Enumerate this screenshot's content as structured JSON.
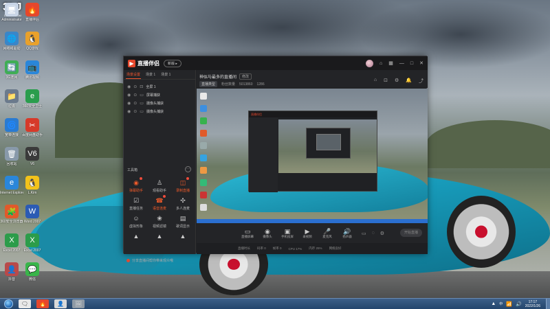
{
  "watermark": "3LJ",
  "watermark_sub": "DOUYU.COM",
  "desktop": {
    "icons_col1": [
      {
        "label": "Administrator",
        "glyph": "🖥"
      },
      {
        "label": "网络和驱动",
        "glyph": "🌐"
      },
      {
        "label": "3G连网",
        "glyph": "🔄"
      },
      {
        "label": "垃圾",
        "glyph": "📁"
      },
      {
        "label": "宽带连接",
        "glyph": "🌀"
      },
      {
        "label": "回收站",
        "glyph": "🗑"
      },
      {
        "label": "Internet Explorer",
        "glyph": "e"
      },
      {
        "label": "360安全浏览器",
        "glyph": "🧩"
      },
      {
        "label": "Excel 2007",
        "glyph": "X"
      },
      {
        "label": "抖音",
        "glyph": "👤"
      }
    ],
    "icons_col2": [
      {
        "label": "直播伴侣",
        "glyph": "🔥"
      },
      {
        "label": "QQ游戏",
        "glyph": "🐧"
      },
      {
        "label": "腾讯视频",
        "glyph": "📺"
      },
      {
        "label": "360安全卫士",
        "glyph": "e"
      },
      {
        "label": "百度网盘助手",
        "glyph": "✂"
      },
      {
        "label": "V6",
        "glyph": "V6"
      },
      {
        "label": "L.Kim",
        "glyph": "🐧"
      },
      {
        "label": "Word 2007",
        "glyph": "W"
      },
      {
        "label": "Excel 2007",
        "glyph": "X"
      },
      {
        "label": "微信",
        "glyph": "💬"
      }
    ]
  },
  "app": {
    "logo_mark": "▶",
    "logo_text": "直播伴侣",
    "version_label": "新版 ▸",
    "titlebar_glyphs": [
      "⌂",
      "▦",
      "—",
      "□",
      "✕"
    ],
    "scene_tabs": [
      "场景设置",
      "场景 1",
      "场景 1"
    ],
    "sources": [
      "全屏 1",
      "屏幕捕获",
      "摄像头捕获",
      "摄像头捕获"
    ],
    "tools_heading": "工具箱",
    "tools_more": "···",
    "tools": [
      {
        "label": "弹幕助手",
        "glyph": "◉",
        "red": true,
        "dot": true
      },
      {
        "label": "观看助手",
        "glyph": "♙",
        "red": false,
        "dot": false
      },
      {
        "label": "录制直播",
        "glyph": "◫",
        "red": true,
        "dot": true
      },
      {
        "label": "直播任务",
        "glyph": "☑",
        "red": false,
        "dot": false
      },
      {
        "label": "语音连麦",
        "glyph": "☎",
        "red": true,
        "dot": true
      },
      {
        "label": "多人连麦",
        "glyph": "✣",
        "red": false,
        "dot": false
      },
      {
        "label": "虚拟形象",
        "glyph": "☺",
        "red": false,
        "dot": false
      },
      {
        "label": "视频滤镜",
        "glyph": "❀",
        "red": false,
        "dot": false
      },
      {
        "label": "歌词显示",
        "glyph": "▤",
        "red": false,
        "dot": false
      },
      {
        "label": "",
        "glyph": "▲",
        "red": false,
        "dot": false
      },
      {
        "label": "",
        "glyph": "▲",
        "red": false,
        "dot": false
      },
      {
        "label": "",
        "glyph": "▲",
        "red": false,
        "dot": false
      }
    ],
    "bottom_tip": "分享直播间帮你带来观众哦",
    "live_title": "神似与最多的直播间",
    "edit_label": "修改",
    "meta": [
      "直播类型",
      "粉丝数量",
      "5013860",
      "1286"
    ],
    "head_icons": [
      "⌂",
      "⊡",
      "⚙",
      "🔔",
      "⤴"
    ],
    "controls": [
      {
        "label": "直播屏幕",
        "glyph": "▭"
      },
      {
        "label": "摄像头",
        "glyph": "◉"
      },
      {
        "label": "手机投屏",
        "glyph": "▣"
      },
      {
        "label": "录视频",
        "glyph": "▶"
      },
      {
        "label": "麦克风",
        "glyph": "🎤"
      },
      {
        "label": "扬声器",
        "glyph": "🔊"
      }
    ],
    "ctrl_extra": [
      "▭",
      "◌",
      "⚙"
    ],
    "start_label": "开始直播",
    "status": [
      "直播时长",
      "码率 0",
      "帧率 0",
      "CPU 17%",
      "内存 25%",
      "网络良好"
    ]
  },
  "nested": {
    "title": "直播伴侣"
  },
  "taskbar": {
    "apps": [
      "🗨",
      "🔥",
      "👤",
      "🖼"
    ],
    "tray_glyphs": [
      "▲",
      "📶",
      "🔊"
    ],
    "lang": "中",
    "time": "17:17",
    "date": "2022/1/26"
  }
}
